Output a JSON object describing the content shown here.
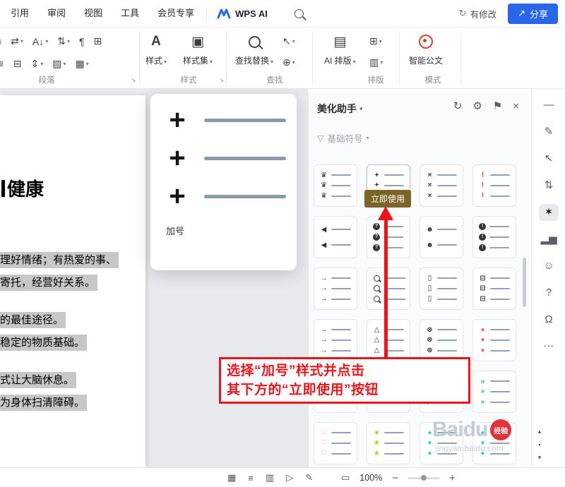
{
  "colors": {
    "accent_blue": "#2a67e8",
    "annotation_red": "#e8151c",
    "tooltip_bg": "#7a6428",
    "highlight_gray": "#c7c7c7"
  },
  "menubar": {
    "items": [
      "引用",
      "审阅",
      "视图",
      "工具",
      "会员专享"
    ],
    "wps_ai": "WPS AI",
    "modified": "有修改",
    "modified_icon": "↻",
    "share": "分享",
    "share_icon": "↗"
  },
  "ribbon": {
    "left_row1": [
      {
        "g": "≡"
      },
      {
        "g": "⇄",
        "caret": true
      },
      {
        "g": "A↓",
        "caret": true
      },
      {
        "g": "⇅",
        "caret": true
      },
      {
        "g": "¶"
      },
      {
        "g": "⊞"
      }
    ],
    "left_row2": [
      {
        "g": "≋"
      },
      {
        "g": "⊟"
      },
      {
        "g": "⇕",
        "caret": true
      },
      {
        "g": "▨",
        "caret": true
      },
      {
        "g": "▦",
        "caret": true
      }
    ],
    "style_button": {
      "label": "样式",
      "icon": "A"
    },
    "styleset_button": {
      "label": "样式集",
      "icon": "▣"
    },
    "find_button": {
      "label": "查找替换"
    },
    "select_small": [
      {
        "g": "↖",
        "caret": true
      },
      {
        "g": "⊕",
        "caret": true
      }
    ],
    "ai_layout_button": {
      "label": "AI 排版",
      "icon": "▤"
    },
    "layout_small": [
      {
        "g": "⊞",
        "caret": true
      },
      {
        "g": "▥",
        "caret": true
      }
    ],
    "smart_doc_button": {
      "label": "智能公文"
    },
    "group_labels": [
      "段落",
      "样式",
      "查找",
      "排版",
      "模式"
    ],
    "expand_icon": "↘",
    "caret_icon": "▾"
  },
  "popup": {
    "label": "加号",
    "symbol": "+",
    "rows": 3
  },
  "panel": {
    "title": "美化助手",
    "caret": "▾",
    "filter": "基础符号",
    "filter_icon": "▽",
    "tooltip": "立即使用",
    "header_icons": [
      {
        "name": "refresh-icon",
        "g": "↻"
      },
      {
        "name": "settings-icon",
        "g": "⚙"
      },
      {
        "name": "pin-icon",
        "g": "⚑"
      },
      {
        "name": "close-icon",
        "g": "×"
      }
    ],
    "cards": [
      {
        "g": "♛",
        "c": "#333",
        "n": 3
      },
      {
        "g": "+",
        "c": "#1a1a1a",
        "n": 3,
        "sel": true
      },
      {
        "g": "×",
        "c": "#333",
        "n": 3
      },
      {
        "g": "!",
        "c": "#e03131",
        "n": 3
      },
      {
        "g": "◀",
        "c": "#333",
        "n": 2
      },
      {
        "g": "?",
        "c": "#fff",
        "bg": "#333",
        "n": 3
      },
      {
        "g": "☻",
        "c": "#333",
        "n": 2
      },
      {
        "g": "!",
        "c": "#fff",
        "bg": "#333",
        "n": 3
      },
      {
        "g": "→",
        "c": "#333",
        "n": 3
      },
      {
        "mag": true,
        "n": 3
      },
      {
        "g": "▯",
        "c": "#333",
        "n": 3
      },
      {
        "g": "⊟",
        "c": "#333",
        "n": 3
      },
      {
        "g": "→",
        "c": "#333",
        "n": 3
      },
      {
        "g": "△",
        "c": "#333",
        "n": 3
      },
      {
        "g": "⊗",
        "c": "#333",
        "n": 3
      },
      {
        "g": "●",
        "c": "#ec5f9a",
        "n": 3
      },
      {
        "g": "♥",
        "c": "#e64980",
        "n": 3
      },
      {
        "rows": [
          {
            "g": "◆",
            "c": "#333"
          },
          {
            "g": "◆",
            "c": "#333"
          },
          {
            "g": "■",
            "c": "#1e88e5"
          }
        ]
      },
      {
        "g": "▶",
        "c": "#1fb0a6",
        "n": 3
      },
      {
        "g": "»",
        "c": "#1fb0a6",
        "n": 3
      },
      {
        "g": "♡",
        "c": "#f783ac",
        "n": 3
      },
      {
        "g": "★",
        "c": "#94d82d",
        "n": 3
      },
      {
        "g": "●",
        "c": "#3bc9db",
        "n": 3
      },
      {
        "g": "●",
        "c": "#3bc9db",
        "n": 3
      }
    ]
  },
  "annotation": {
    "line1": "选择“加号”样式并点击",
    "line2": "其下方的“立即使用”按钮"
  },
  "document": {
    "heading": "健康",
    "lines": [
      "理好情绪；有热爱的事、",
      "寄托，经营好关系。",
      "的最佳途径。",
      "稳定的物质基础。",
      "式让大脑休息。",
      "为身体扫清障碍。"
    ]
  },
  "toolbar_right": {
    "icons": [
      {
        "name": "collapse-icon",
        "g": "—"
      },
      {
        "name": "pen-icon",
        "g": "✎"
      },
      {
        "name": "select-tool-icon",
        "g": "↖"
      },
      {
        "name": "adjust-icon",
        "g": "⇅"
      },
      {
        "name": "beautify-tool-icon",
        "g": "✶",
        "active": true
      },
      {
        "name": "chart-icon",
        "g": "▂▅"
      },
      {
        "name": "contacts-icon",
        "g": "☺"
      },
      {
        "name": "help-icon",
        "g": "?"
      },
      {
        "name": "support-icon",
        "g": "Ω"
      },
      {
        "name": "more-icon",
        "g": "⋯"
      }
    ],
    "nav": [
      {
        "name": "prev-page-icon",
        "g": "▴"
      },
      {
        "name": "browse-object-icon",
        "g": "▪"
      },
      {
        "name": "next-page-icon",
        "g": "▾"
      }
    ]
  },
  "statusbar": {
    "left_icons": [
      {
        "name": "page-layout-view-icon",
        "g": "▦"
      },
      {
        "name": "outline-view-icon",
        "g": "≡"
      },
      {
        "name": "column-view-icon",
        "g": "▥"
      },
      {
        "name": "read-mode-icon",
        "g": "▷"
      },
      {
        "name": "edit-mode-icon",
        "g": "✎"
      }
    ],
    "fit_icon": "▭",
    "zoom": "100%",
    "zoom_out": "−",
    "zoom_in": "+"
  },
  "watermark": {
    "brand": "Baidu",
    "badge": "经验",
    "url": "jingyan.baidu.com"
  }
}
